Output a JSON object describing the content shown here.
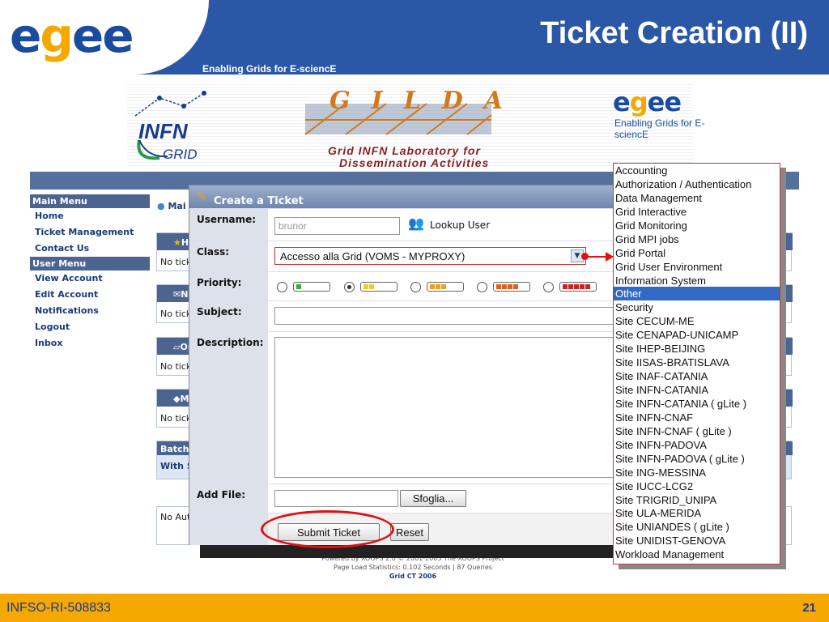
{
  "slide": {
    "title": "Ticket Creation (II)",
    "tagline": "Enabling Grids for E-sciencE",
    "footer_left": "INFSO-RI-508833",
    "page_number": "21",
    "brand_blue": "#2a58a6",
    "brand_orange": "#f4a800"
  },
  "banner": {
    "infn": "INFN",
    "infn_grid": "GRID",
    "gilda": "GILDA",
    "gilda_line1": "Grid INFN Laboratory for",
    "gilda_line2": "Dissemination Activities",
    "egee_tag": "Enabling Grids for E-sciencE"
  },
  "side_menu": {
    "main_title": "Main Menu",
    "main_items": [
      "Home",
      "Ticket Management",
      "Contact Us"
    ],
    "user_title": "User Menu",
    "user_items": [
      "View Account",
      "Edit Account",
      "Notifications",
      "Logout",
      "Inbox"
    ]
  },
  "main_blocks": {
    "heading_fragment": "Mai",
    "block_titles": [
      "Hig",
      "Nev",
      "Op",
      "My"
    ],
    "block_text": "No tick",
    "batch_title": "Batch",
    "batch_text": "With S",
    "no_aut": "No Aut"
  },
  "dialog": {
    "title": "Create a Ticket",
    "username_label": "Username:",
    "username_value": "brunor",
    "lookup_label": "Lookup User",
    "class_label": "Class:",
    "class_value": "Accesso alla Grid (VOMS - MYPROXY)",
    "priority_label": "Priority:",
    "priority_selected": 1,
    "priority_levels": [
      1,
      2,
      3,
      4,
      5
    ],
    "subject_label": "Subject:",
    "subject_value": "",
    "description_label": "Description:",
    "description_value": "",
    "add_file_label": "Add File:",
    "browse_label": "Sfoglia...",
    "submit_label": "Submit Ticket",
    "reset_label": "Reset"
  },
  "class_options": [
    "Accounting",
    "Authorization / Authentication",
    "Data Management",
    "Grid Interactive",
    "Grid Monitoring",
    "Grid MPI jobs",
    "Grid Portal",
    "Grid User Environment",
    "Information System",
    "Other",
    "Security",
    "Site CECUM-ME",
    "Site CENAPAD-UNICAMP",
    "Site IHEP-BEIJING",
    "Site IISAS-BRATISLAVA",
    "Site INAF-CATANIA",
    "Site INFN-CATANIA",
    "Site INFN-CATANIA ( gLite )",
    "Site INFN-CNAF",
    "Site INFN-CNAF ( gLite )",
    "Site INFN-PADOVA",
    "Site INFN-PADOVA ( gLite )",
    "Site ING-MESSINA",
    "Site IUCC-LCG2",
    "Site TRIGRID_UNIPA",
    "Site ULA-MERIDA",
    "Site UNIANDES ( gLite )",
    "Site UNIDIST-GENOVA",
    "Workload Management"
  ],
  "class_highlighted": "Other",
  "powered": {
    "line1": "Powered by XOOPS 2.0 © 2001-2003 The XOOPS Project",
    "line2": "Page Load Statistics: 0.102 Seconds | 87 Queries",
    "line3": "Grid CT 2006"
  }
}
